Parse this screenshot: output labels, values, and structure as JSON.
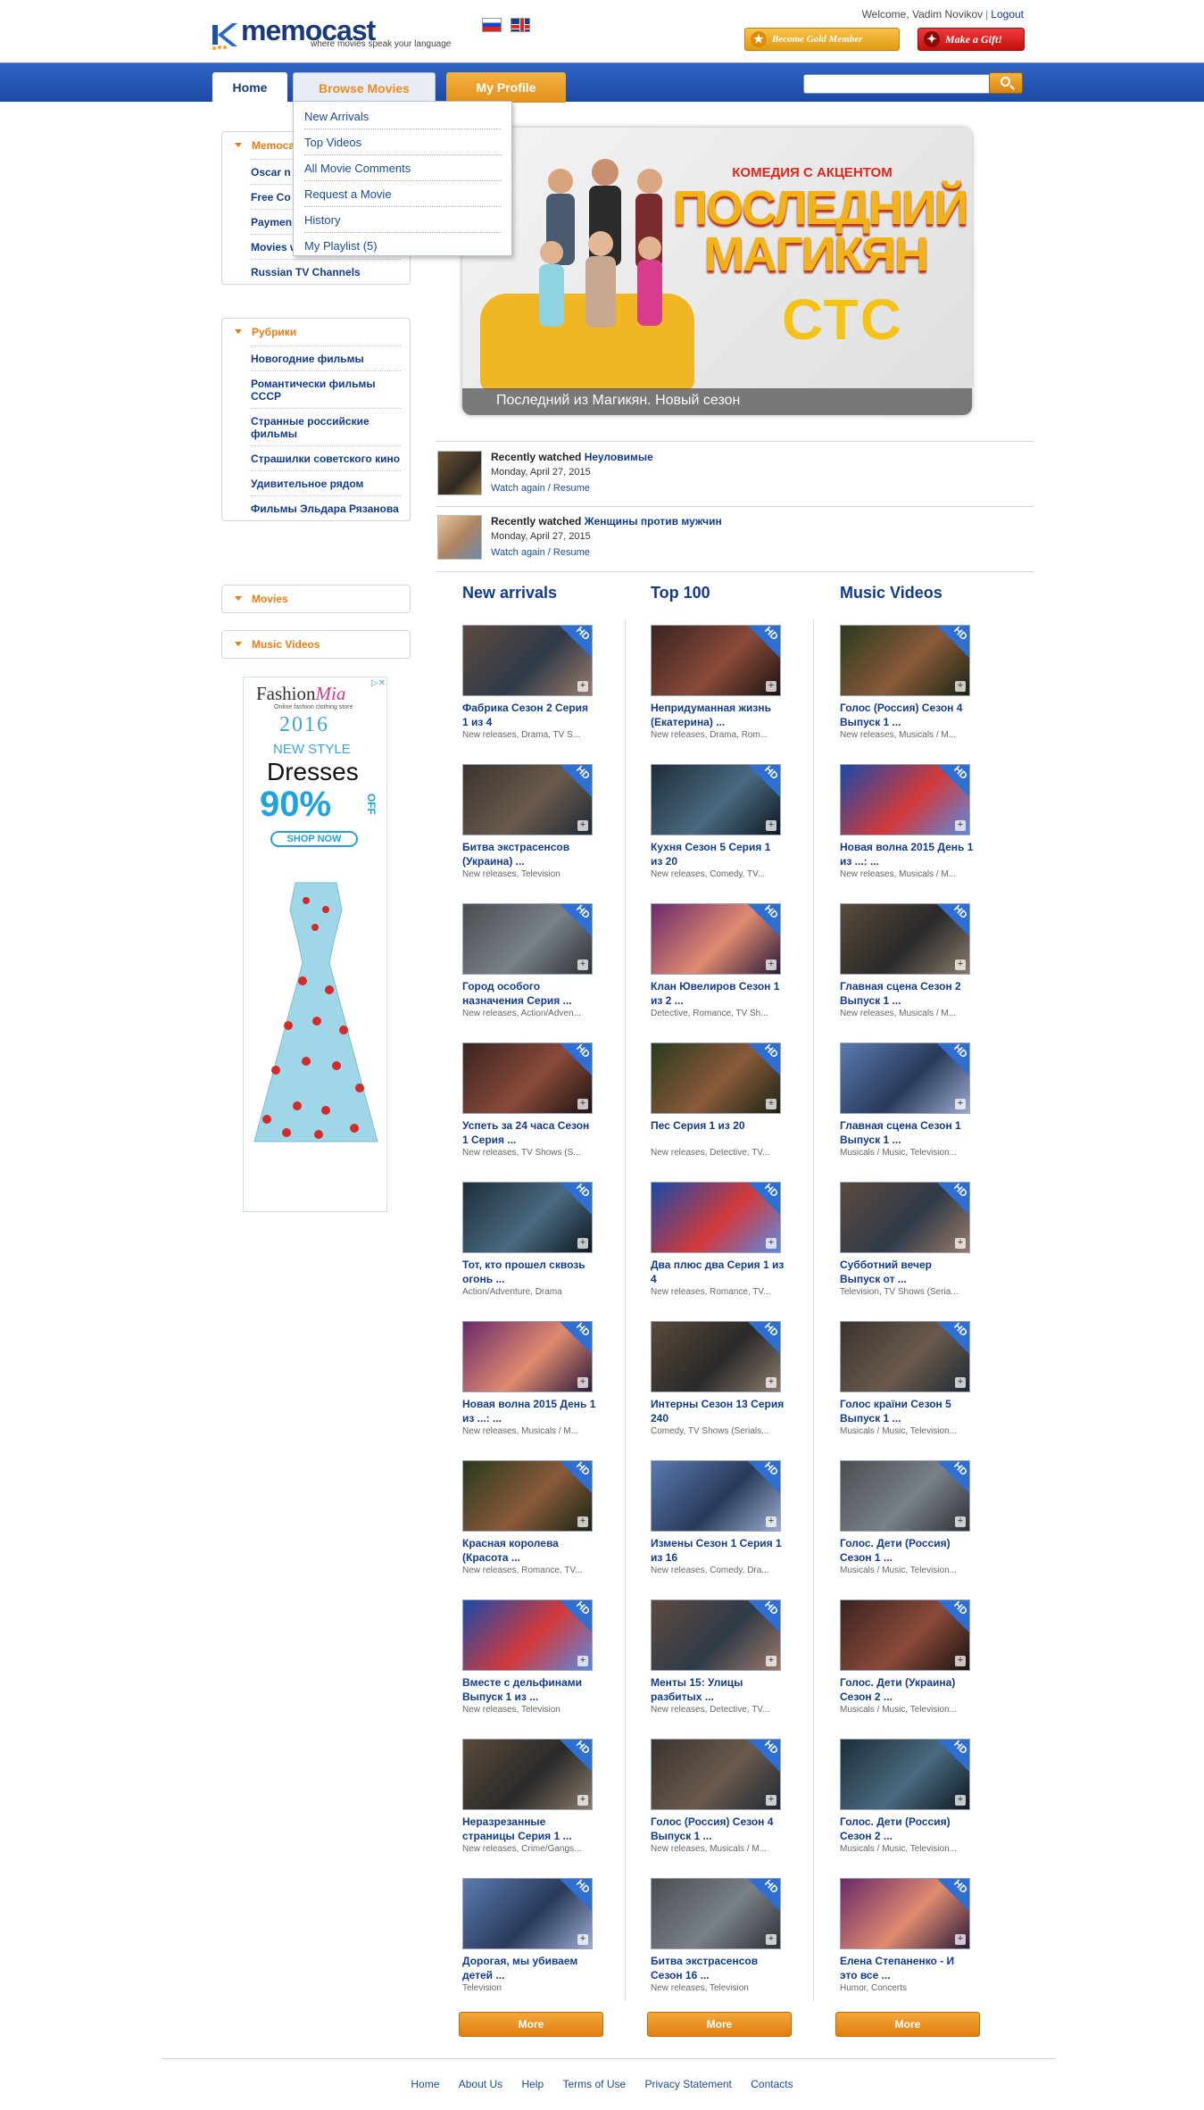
{
  "header": {
    "logo_word": "memocast",
    "logo_tagline": "where movies speak your language",
    "welcome": "Welcome, Vadim Novikov",
    "logout": "Logout",
    "gold_button": "Become Gold Member",
    "gift_button": "Make a Gift!",
    "search_placeholder": "",
    "brand_colors": {
      "nav_blue": "#2f64c4",
      "orange": "#f08a1c",
      "link": "#123b8f"
    }
  },
  "nav": {
    "home": "Home",
    "browse": "Browse Movies",
    "profile": "My Profile"
  },
  "dropdown": [
    "New Arrivals",
    "Top Videos",
    "All Movie Comments",
    "Request a Movie",
    "History",
    "My Playlist (5)"
  ],
  "sidebar": {
    "box1": {
      "title": "Memocast",
      "items": [
        "Oscar n",
        "Free Co",
        "Paymen",
        "Movies with subtitles",
        "Russian TV Channels"
      ]
    },
    "box2": {
      "title": "Рубрики",
      "items": [
        "Новогодние фильмы",
        "Романтически фильмы СССР",
        "Странные российские фильмы",
        "Страшилки советского кино",
        "Удивительное рядом",
        "Фильмы Эльдара Рязанова"
      ]
    },
    "movies": "Movies",
    "music_videos": "Music Videos"
  },
  "ad": {
    "brand_a": "Fashion",
    "brand_b": "Mia",
    "brand_sub": "Online fashion clothing store",
    "year": "2016",
    "new_style": "NEW STYLE",
    "dresses": "Dresses",
    "percent": "90%",
    "off": "OFF",
    "shop": "SHOP NOW"
  },
  "banner": {
    "top_line": "КОМЕДИЯ С АКЦЕНТОМ",
    "title_line1": "ПОСЛЕДНИЙ",
    "title_line2": "МАГИКЯН",
    "channel": "СТС",
    "caption": "Последний из Магикян. Новый сезон"
  },
  "recent": [
    {
      "label": "Recently watched",
      "title": "Неуловимые",
      "date": "Monday, April 27, 2015",
      "action": "Watch again / Resume"
    },
    {
      "label": "Recently watched",
      "title": "Женщины против мужчин",
      "date": "Monday, April 27, 2015",
      "action": "Watch again / Resume"
    }
  ],
  "columns": [
    {
      "heading": "New arrivals",
      "more": "More",
      "items": [
        {
          "title": "Фабрика Сезон 2 Серия 1 из 4",
          "meta": "New releases, Drama, TV S..."
        },
        {
          "title": "Битва экстрасенсов (Украина) ...",
          "meta": "New releases, Television"
        },
        {
          "title": "Город особого назначения Серия ...",
          "meta": "New releases, Action/Adven..."
        },
        {
          "title": "Успеть за 24 часа Сезон 1 Серия ...",
          "meta": "New releases, TV Shows (S..."
        },
        {
          "title": "Тот, кто прошел сквозь огонь ...",
          "meta": "Action/Adventure, Drama"
        },
        {
          "title": "Новая волна 2015 День 1 из ...: ...",
          "meta": "New releases, Musicals / M..."
        },
        {
          "title": "Красная королева (Красота ...",
          "meta": "New releases, Romance, TV..."
        },
        {
          "title": "Вместе с дельфинами Выпуск 1 из ...",
          "meta": "New releases, Television"
        },
        {
          "title": "Неразрезанные страницы Серия 1 ...",
          "meta": "New releases, Crime/Gangs..."
        },
        {
          "title": "Дорогая, мы убиваем детей ...",
          "meta": "Television"
        }
      ]
    },
    {
      "heading": "Top 100",
      "more": "More",
      "items": [
        {
          "title": "Непридуманная жизнь (Екатерина) ...",
          "meta": "New releases, Drama, Rom..."
        },
        {
          "title": "Кухня Сезон 5 Серия 1 из 20",
          "meta": "New releases, Comedy, TV..."
        },
        {
          "title": "Клан Ювелиров Сезон 1 из 2 ...",
          "meta": "Detective, Romance, TV Sh..."
        },
        {
          "title": "Пес Серия 1 из 20",
          "meta": "New releases, Detective, TV..."
        },
        {
          "title": "Два плюс два Серия 1 из 4",
          "meta": "New releases, Romance, TV..."
        },
        {
          "title": "Интерны Сезон 13 Серия 240",
          "meta": "Comedy, TV Shows (Serials..."
        },
        {
          "title": "Измены Сезон 1 Серия 1 из 16",
          "meta": "New releases, Comedy, Dra..."
        },
        {
          "title": "Менты 15: Улицы разбитых ...",
          "meta": "New releases, Detective, TV..."
        },
        {
          "title": "Голос (Россия) Сезон 4 Выпуск 1 ...",
          "meta": "New releases, Musicals / M..."
        },
        {
          "title": "Битва экстрасенсов Сезон 16 ...",
          "meta": "New releases, Television"
        }
      ]
    },
    {
      "heading": "Music Videos",
      "more": "More",
      "items": [
        {
          "title": "Голос (Россия) Сезон 4 Выпуск 1 ...",
          "meta": "New releases, Musicals / M..."
        },
        {
          "title": "Новая волна 2015 День 1 из ...: ...",
          "meta": "New releases, Musicals / M..."
        },
        {
          "title": "Главная сцена Сезон 2 Выпуск 1 ...",
          "meta": "New releases, Musicals / M..."
        },
        {
          "title": "Главная сцена Сезон 1 Выпуск 1 ...",
          "meta": "Musicals / Music, Television..."
        },
        {
          "title": "Субботний вечер Выпуск от ...",
          "meta": "Television, TV Shows (Seria..."
        },
        {
          "title": "Голос країни Сезон 5 Выпуск 1 ...",
          "meta": "Musicals / Music, Television..."
        },
        {
          "title": "Голос. Дети (Россия) Сезон 1 ...",
          "meta": "Musicals / Music, Television..."
        },
        {
          "title": "Голос. Дети (Украина) Сезон 2 ...",
          "meta": "Musicals / Music, Television..."
        },
        {
          "title": "Голос. Дети (Россия) Сезон 2 ...",
          "meta": "Musicals / Music, Television..."
        },
        {
          "title": "Елена Степаненко - И это все ...",
          "meta": "Humor, Concerts"
        }
      ]
    }
  ],
  "hd_badge": "HD",
  "footer": [
    "Home",
    "About Us",
    "Help",
    "Terms of Use",
    "Privacy Statement",
    "Contacts"
  ]
}
